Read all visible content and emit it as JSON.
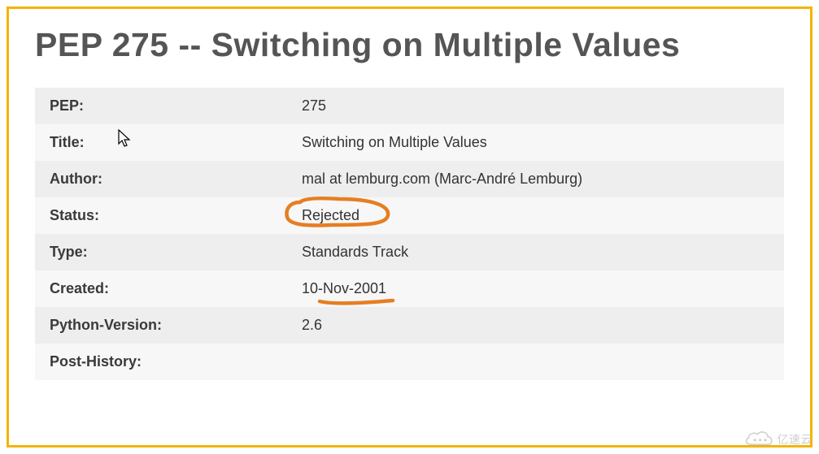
{
  "title": "PEP 275 -- Switching on Multiple Values",
  "fields": {
    "pep": {
      "label": "PEP:",
      "value": "275"
    },
    "title_field": {
      "label": "Title:",
      "value": "Switching on Multiple Values"
    },
    "author": {
      "label": "Author:",
      "value": "mal at lemburg.com (Marc-André Lemburg)"
    },
    "status": {
      "label": "Status:",
      "value": "Rejected"
    },
    "type": {
      "label": "Type:",
      "value": "Standards Track"
    },
    "created": {
      "label": "Created:",
      "value": "10-Nov-2001"
    },
    "python_version": {
      "label": "Python-Version:",
      "value": "2.6"
    },
    "post_history": {
      "label": "Post-History:",
      "value": ""
    }
  },
  "watermark": "亿速云",
  "annotations": {
    "status_circled": true,
    "created_underlined": true
  }
}
